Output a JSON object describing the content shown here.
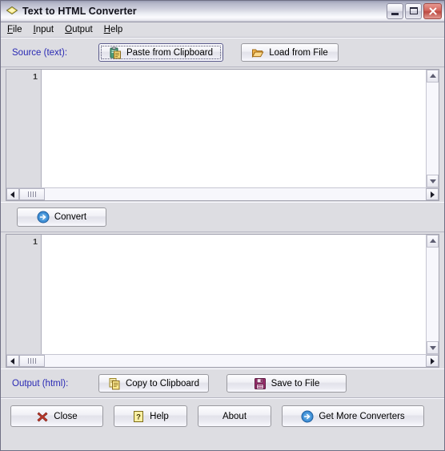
{
  "window": {
    "title": "Text to HTML Converter",
    "icon": "diamond-document-icon",
    "controls": {
      "minimize": "Minimize",
      "maximize": "Maximize",
      "close": "Close"
    }
  },
  "menubar": {
    "items": [
      {
        "label": "File",
        "accel": "F"
      },
      {
        "label": "Input",
        "accel": "I"
      },
      {
        "label": "Output",
        "accel": "O"
      },
      {
        "label": "Help",
        "accel": "H"
      }
    ]
  },
  "source_section": {
    "label": "Source (text):",
    "paste_button": {
      "label": "Paste from Clipboard",
      "icon": "clipboard-paste-icon",
      "focused": true
    },
    "load_button": {
      "label": "Load from File",
      "icon": "open-folder-icon"
    }
  },
  "source_editor": {
    "line_numbers": [
      "1"
    ],
    "content": "",
    "h_scroll_position": 0,
    "v_scroll_position": 0
  },
  "convert": {
    "label": "Convert",
    "icon": "blue-arrow-circle-icon"
  },
  "output_editor": {
    "line_numbers": [
      "1"
    ],
    "content": "",
    "h_scroll_position": 0,
    "v_scroll_position": 0
  },
  "output_section": {
    "label": "Output (html):",
    "copy_button": {
      "label": "Copy to Clipboard",
      "icon": "copy-pages-icon"
    },
    "save_button": {
      "label": "Save to File",
      "icon": "floppy-save-icon"
    }
  },
  "bottom_bar": {
    "close_button": {
      "label": "Close",
      "icon": "red-x-icon"
    },
    "help_button": {
      "label": "Help",
      "icon": "yellow-question-icon"
    },
    "about_button": {
      "label": "About",
      "icon": "none"
    },
    "more_button": {
      "label": "Get More Converters",
      "icon": "blue-arrow-circle-icon"
    }
  },
  "colors": {
    "accent_label": "#2a2ab4",
    "panel_bg": "#dddde2",
    "editor_bg": "#ffffff",
    "gutter_bg": "#dcdce1",
    "close_red": "#c0392b",
    "convert_blue": "#2f7fd0"
  }
}
